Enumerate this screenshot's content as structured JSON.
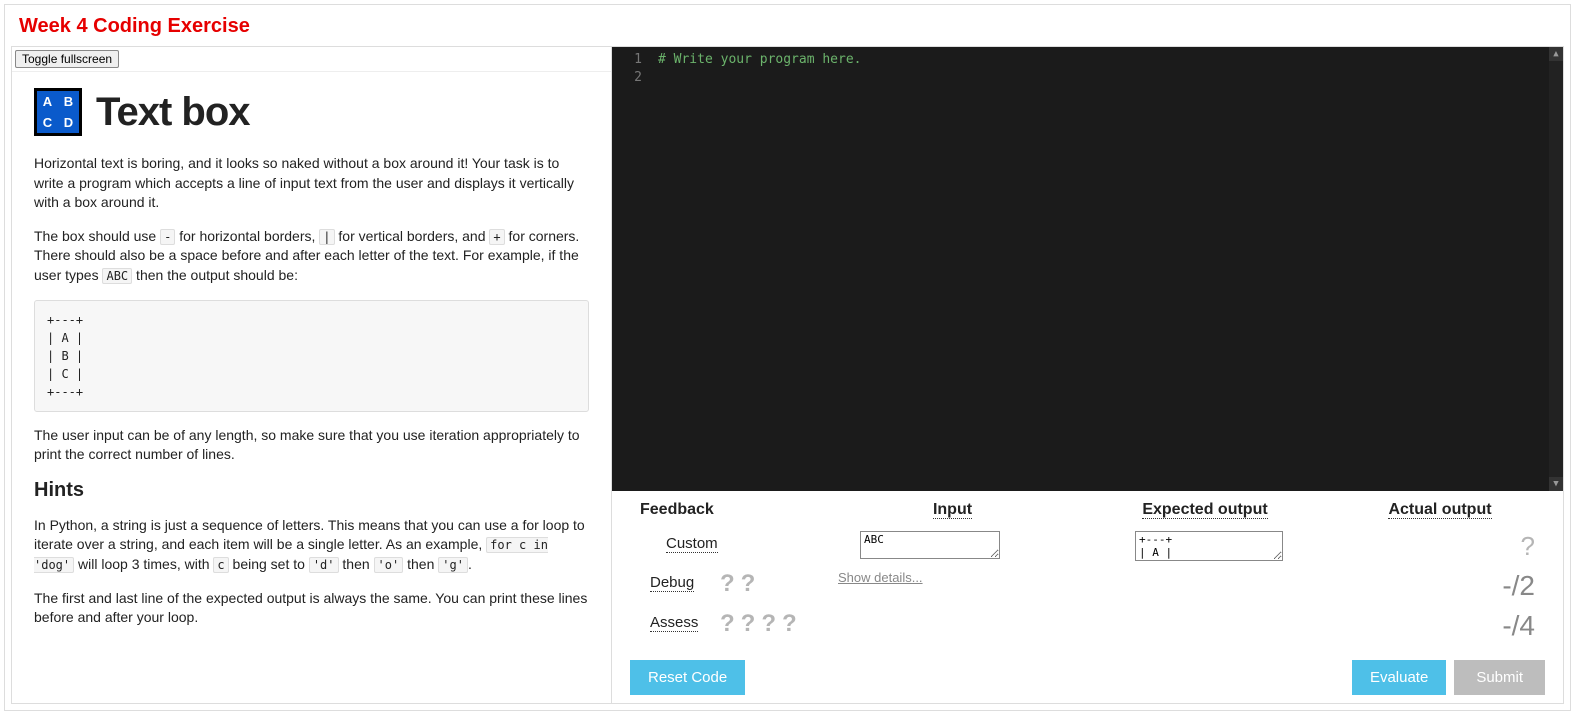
{
  "page": {
    "title": "Week 4 Coding Exercise",
    "toggle_label": "Toggle fullscreen"
  },
  "prompt": {
    "icon_letters": [
      "A",
      "B",
      "C",
      "D"
    ],
    "title": "Text box",
    "p1": "Horizontal text is boring, and it looks so naked without a box around it! Your task is to write a program which accepts a line of input text from the user and displays it vertically with a box around it.",
    "p2a": "The box should use ",
    "p2_dash": "-",
    "p2b": " for horizontal borders, ",
    "p2_pipe": "|",
    "p2c": " for vertical borders, and ",
    "p2_plus": "+",
    "p2d": " for corners. There should also be a space before and after each letter of the text. For example, if the user types ",
    "p2_abc": "ABC",
    "p2e": " then the output should be:",
    "example_block": "+---+\n| A |\n| B |\n| C |\n+---+",
    "p3": "The user input can be of any length, so make sure that you use iteration appropriately to print the correct number of lines.",
    "hints_title": "Hints",
    "p4a": "In Python, a string is just a sequence of letters. This means that you can use a for loop to iterate over a string, and each item will be a single letter. As an example, ",
    "p4_code1": "for c in 'dog'",
    "p4b": " will loop 3 times, with ",
    "p4_c": "c",
    "p4c": " being set to ",
    "p4_d": "'d'",
    "p4d": " then ",
    "p4_o": "'o'",
    "p4e": " then ",
    "p4_g": "'g'",
    "p4f": ".",
    "p5": "The first and last line of the expected output is always the same. You can print these lines before and after your loop."
  },
  "editor": {
    "line1_num": "1",
    "line2_num": "2",
    "line1_text": "# Write your program here."
  },
  "results": {
    "heading_feedback": "Feedback",
    "heading_input": "Input",
    "heading_expected": "Expected output",
    "heading_actual": "Actual output",
    "custom_label": "Custom",
    "debug_label": "Debug",
    "assess_label": "Assess",
    "custom_input": "ABC",
    "custom_expected": "+---+\n| A |",
    "custom_actual": "?",
    "show_details": "Show details...",
    "debug_score": "-/2",
    "assess_score": "-/4",
    "qmark": "?"
  },
  "buttons": {
    "reset": "Reset Code",
    "evaluate": "Evaluate",
    "submit": "Submit"
  }
}
